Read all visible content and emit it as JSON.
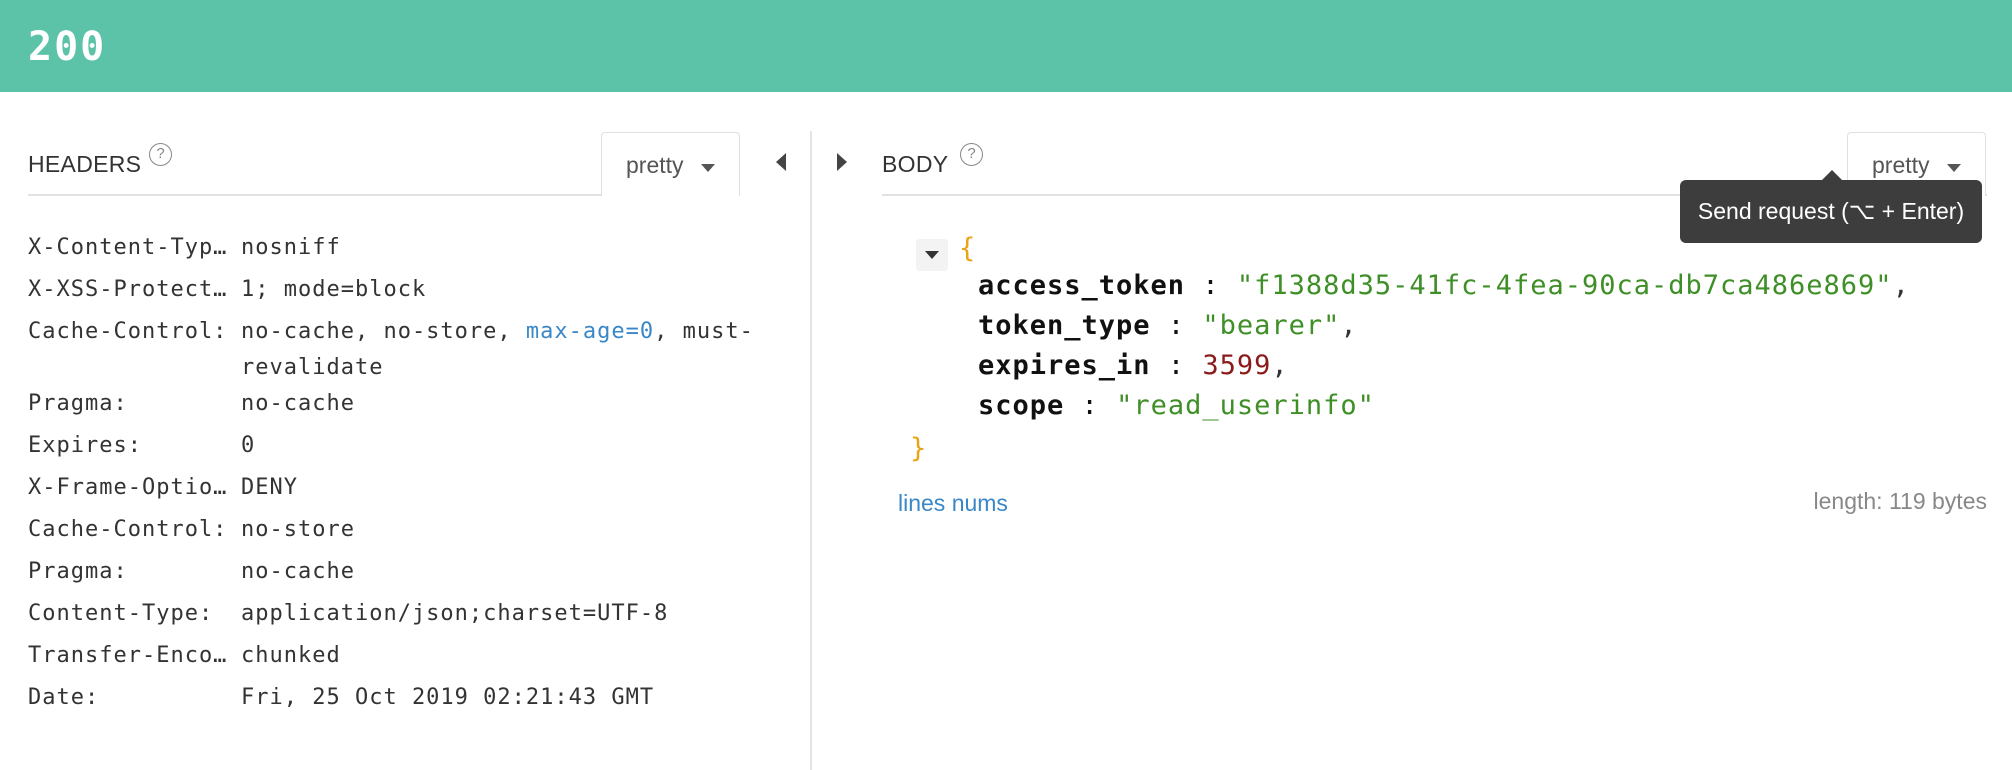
{
  "status": {
    "code": "200",
    "color": "#5cc2a8"
  },
  "headers": {
    "title": "HEADERS",
    "help": "?",
    "format": "pretty",
    "rows": [
      {
        "key": "X-Content-Typ…",
        "value": "nosniff"
      },
      {
        "key": "X-XSS-Protect…",
        "value": "1; mode=block"
      },
      {
        "key": "Cache-Control:",
        "value_pre": "no-cache, no-store, ",
        "value_link": "max-age=0",
        "value_post": ", must-revalidate"
      },
      {
        "key": "Pragma:",
        "value": "no-cache"
      },
      {
        "key": "Expires:",
        "value": "0"
      },
      {
        "key": "X-Frame-Optio…",
        "value": "DENY"
      },
      {
        "key": "Cache-Control:",
        "value": "no-store"
      },
      {
        "key": "Pragma:",
        "value": "no-cache"
      },
      {
        "key": "Content-Type:",
        "value": "application/json;charset=UTF-8"
      },
      {
        "key": "Transfer-Enco…",
        "value": "chunked"
      },
      {
        "key": "Date:",
        "value": "Fri, 25 Oct 2019 02:21:43 GMT"
      }
    ]
  },
  "body": {
    "title": "BODY",
    "help": "?",
    "format": "pretty",
    "open_brace": "{",
    "close_brace": "}",
    "fields": [
      {
        "key": "access_token",
        "value": "\"f1388d35-41fc-4fea-90ca-db7ca486e869\"",
        "type": "string",
        "comma": ","
      },
      {
        "key": "token_type",
        "value": "\"bearer\"",
        "type": "string",
        "comma": ","
      },
      {
        "key": "expires_in",
        "value": "3599",
        "type": "number",
        "comma": ","
      },
      {
        "key": "scope",
        "value": "\"read_userinfo\"",
        "type": "string",
        "comma": ""
      }
    ],
    "lines_nums": "lines nums",
    "length": "length: 119 bytes"
  },
  "tooltip": {
    "text": "Send request (⌥ + Enter)"
  }
}
